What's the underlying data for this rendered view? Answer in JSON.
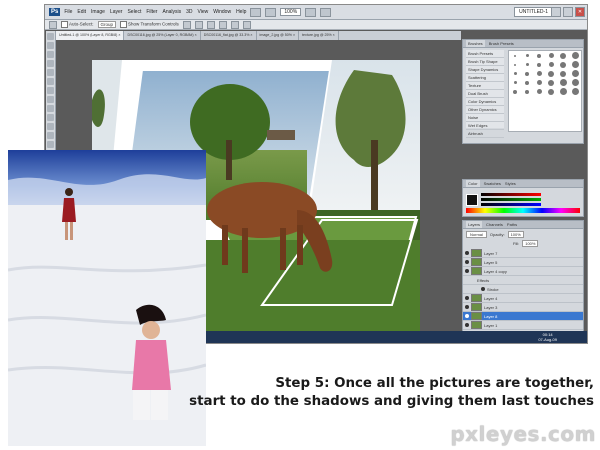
{
  "app": {
    "logo": "Ps",
    "menu": [
      "File",
      "Edit",
      "Image",
      "Layer",
      "Select",
      "Filter",
      "Analysis",
      "3D",
      "View",
      "Window",
      "Help"
    ],
    "zoom": "100%",
    "workspace": "UNTITLED-1",
    "options_bar": {
      "auto_select_label": "Auto-Select:",
      "auto_select_value": "Group",
      "show_transform_label": "Show Transform Controls"
    },
    "doc_tabs": [
      "Untitled-1 @ 100% (Layer 8, RGB/8) ×",
      "DSC00116.jpg @ 25% (Layer 0, RGB/8#) ×",
      "DSC00116_flat.jpg @ 33.3% ×",
      "image_2.jpg @ 50% ×",
      "texture.jpg @ 25% ×"
    ]
  },
  "panels": {
    "brushes": {
      "tabs": [
        "Brushes",
        "Brush Presets"
      ],
      "list": [
        "Brush Presets",
        "Brush Tip Shape",
        "Shape Dynamics",
        "Scattering",
        "Texture",
        "Dual Brush",
        "Color Dynamics",
        "Other Dynamics",
        "Noise",
        "Wet Edges",
        "Airbrush"
      ]
    },
    "color": {
      "tabs": [
        "Color",
        "Swatches",
        "Styles"
      ]
    },
    "layers": {
      "tabs": [
        "Layers",
        "Channels",
        "Paths"
      ],
      "blend_mode": "Normal",
      "opacity_label": "Opacity:",
      "opacity": "100%",
      "fill_label": "Fill:",
      "fill": "100%",
      "items": [
        {
          "name": "Layer 7",
          "selected": false
        },
        {
          "name": "Layer 5",
          "selected": false
        },
        {
          "name": "Layer 4 copy",
          "selected": false
        },
        {
          "name": "Effects",
          "selected": false
        },
        {
          "name": "Stroke",
          "selected": false
        },
        {
          "name": "Layer 4",
          "selected": false
        },
        {
          "name": "Layer 3",
          "selected": false
        },
        {
          "name": "Layer 8",
          "selected": true
        },
        {
          "name": "Layer 1",
          "selected": false
        }
      ]
    }
  },
  "taskbar": {
    "time": "00:14",
    "date": "07-Aug-09"
  },
  "caption": {
    "line1": "Step 5: Once all the pictures are together,",
    "line2": "start to do the shadows and giving them last touches"
  },
  "watermark": "pxleyes.com",
  "colors": {
    "selection_blue": "#3a78d0",
    "title_bar": "#d9dde3",
    "taskbar": "#1f3556"
  }
}
